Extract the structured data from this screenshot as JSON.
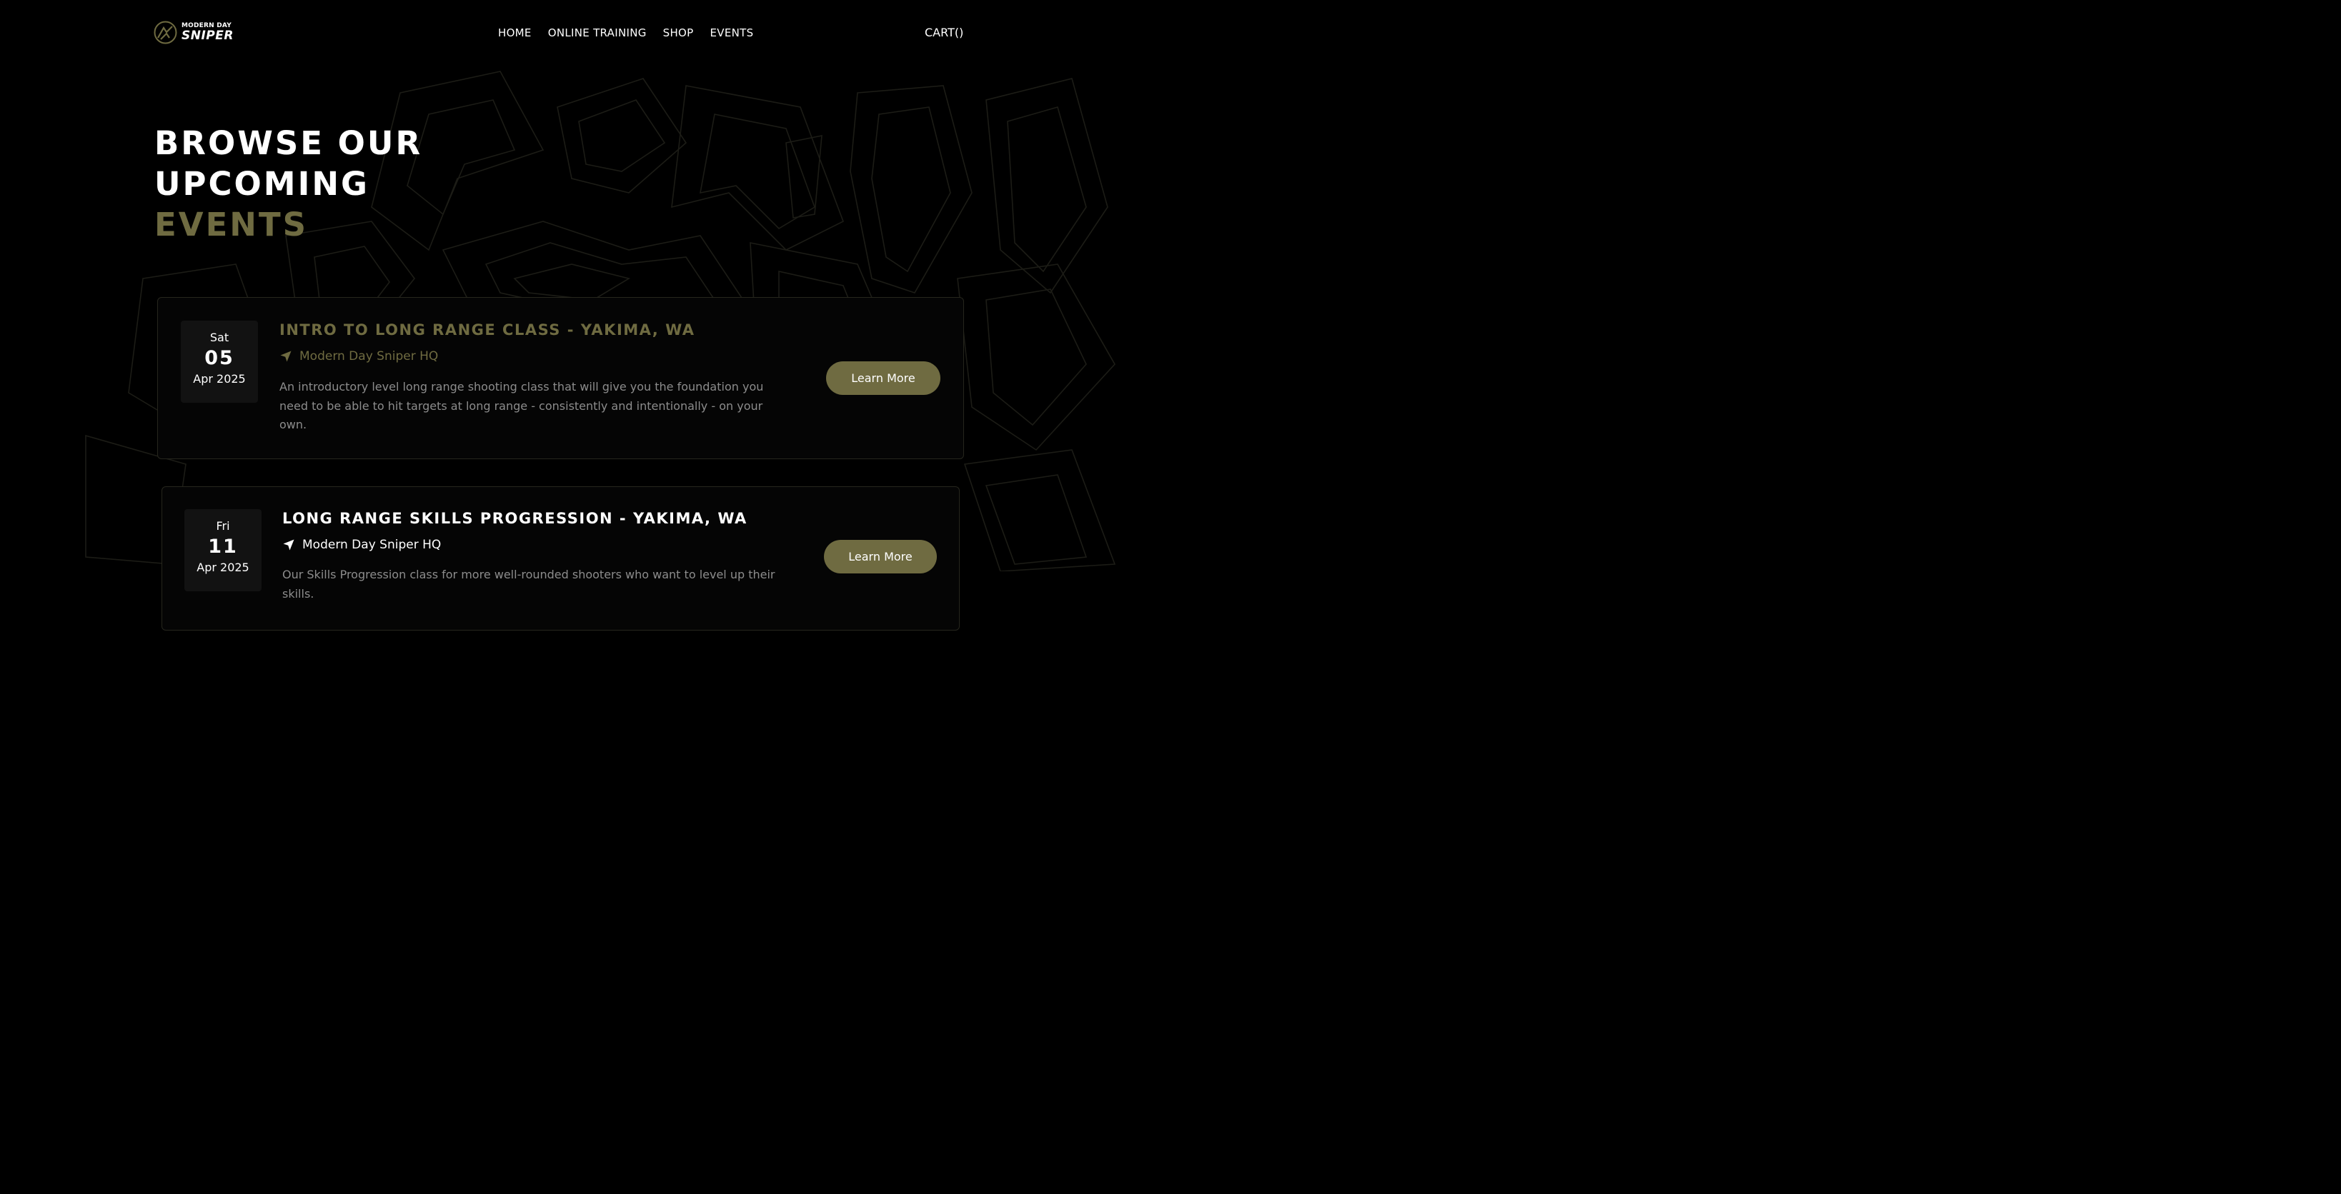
{
  "brand": {
    "small": "MODERN DAY",
    "big": "SNIPER"
  },
  "nav": [
    "HOME",
    "ONLINE TRAINING",
    "SHOP",
    "EVENTS"
  ],
  "cart": "CART()",
  "hero": {
    "line1": "BROWSE OUR",
    "line2": "UPCOMING",
    "line3": "EVENTS"
  },
  "events": [
    {
      "dow": "Sat",
      "day": "05",
      "month": "Apr 2025",
      "title": "INTRO TO LONG RANGE CLASS - YAKIMA, WA",
      "location": "Modern Day Sniper HQ",
      "description": "An introductory level long range shooting class that will give you the foundation you need to be able to hit targets at long range - consistently and intentionally - on your own.",
      "button": "Learn More"
    },
    {
      "dow": "Fri",
      "day": "11",
      "month": "Apr 2025",
      "title": "LONG RANGE SKILLS PROGRESSION - YAKIMA, WA",
      "location": "Modern Day Sniper HQ",
      "description": "Our Skills Progression class for more well-rounded shooters who want to level up their skills.",
      "button": "Learn More"
    }
  ],
  "colors": {
    "accent": "#6f6b41",
    "background": "#000000",
    "card": "#050505",
    "muted_text": "#8c8c8c"
  }
}
